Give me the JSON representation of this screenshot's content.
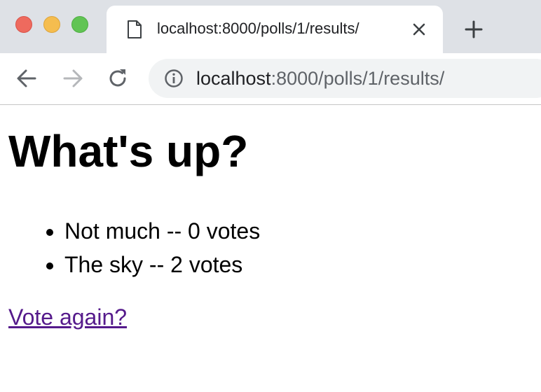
{
  "browser": {
    "tab": {
      "title": "localhost:8000/polls/1/results/",
      "icon": "page-icon",
      "close_icon": "close-icon"
    },
    "new_tab_icon": "plus-icon",
    "nav": {
      "back_icon": "arrow-left-icon",
      "forward_icon": "arrow-right-icon",
      "reload_icon": "reload-icon"
    },
    "address_bar": {
      "info_icon": "info-icon",
      "host": "localhost",
      "rest": ":8000/polls/1/results/"
    },
    "colors": {
      "titlebar": "#dee1e6",
      "omnibox": "#f1f3f4",
      "visited_link": "#551a8b"
    }
  },
  "page": {
    "heading": "What's up?",
    "results": [
      {
        "text": "Not much -- 0 votes"
      },
      {
        "text": "The sky -- 2 votes"
      }
    ],
    "vote_again_link": "Vote again?"
  }
}
